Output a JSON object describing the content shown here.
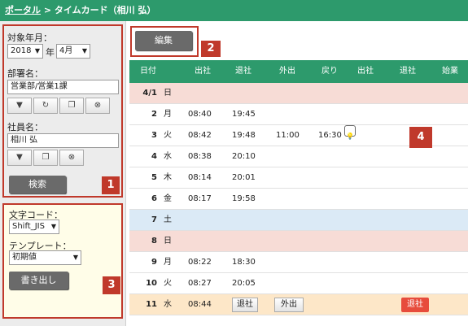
{
  "header": {
    "portal_link": "ポータル",
    "separator": " > ",
    "title": "タイムカード（相川 弘）"
  },
  "sidebar": {
    "period_label": "対象年月：",
    "year_value": "2018",
    "year_unit": "年",
    "month_value": "4月",
    "dept_label": "部署名：",
    "dept_value": "営業部/営業1課",
    "employee_label": "社員名：",
    "employee_value": "相川 弘",
    "search_label": "検索",
    "encoding_label": "文字コード：",
    "encoding_value": "Shift_JIS",
    "template_label": "テンプレート：",
    "template_value": "初期値",
    "export_label": "書き出し"
  },
  "toolbar": {
    "edit_label": "編集"
  },
  "badges": [
    "1",
    "2",
    "3",
    "4"
  ],
  "table": {
    "headers": [
      "日付",
      "出社",
      "退社",
      "外出",
      "戻り",
      "出社",
      "退社",
      "始業"
    ],
    "rows": [
      {
        "date": "4/1",
        "wd": "日",
        "in": "",
        "out": "",
        "go": "",
        "back": "",
        "kind": "hol"
      },
      {
        "date": "2",
        "wd": "月",
        "in": "08:40",
        "out": "19:45",
        "go": "",
        "back": "",
        "kind": ""
      },
      {
        "date": "3",
        "wd": "火",
        "in": "08:42",
        "out": "19:48",
        "go": "11:00",
        "back": "16:30",
        "kind": "",
        "memo": true
      },
      {
        "date": "4",
        "wd": "水",
        "in": "08:38",
        "out": "20:10",
        "go": "",
        "back": "",
        "kind": ""
      },
      {
        "date": "5",
        "wd": "木",
        "in": "08:14",
        "out": "20:01",
        "go": "",
        "back": "",
        "kind": ""
      },
      {
        "date": "6",
        "wd": "金",
        "in": "08:17",
        "out": "19:58",
        "go": "",
        "back": "",
        "kind": ""
      },
      {
        "date": "7",
        "wd": "土",
        "in": "",
        "out": "",
        "go": "",
        "back": "",
        "kind": "sat"
      },
      {
        "date": "8",
        "wd": "日",
        "in": "",
        "out": "",
        "go": "",
        "back": "",
        "kind": "hol"
      },
      {
        "date": "9",
        "wd": "月",
        "in": "08:22",
        "out": "18:30",
        "go": "",
        "back": "",
        "kind": ""
      },
      {
        "date": "10",
        "wd": "火",
        "in": "08:27",
        "out": "20:05",
        "go": "",
        "back": "",
        "kind": ""
      },
      {
        "date": "11",
        "wd": "水",
        "in": "08:44",
        "out": "",
        "go": "",
        "back": "",
        "kind": "cur"
      }
    ],
    "today_buttons": {
      "leave": "退社",
      "go_out": "外出",
      "leave_red": "退社"
    }
  },
  "colors": {
    "accent": "#2d9a6c",
    "marker": "#c0392b",
    "holiday": "#f7dcd6",
    "saturday": "#dbeaf6",
    "today": "#fde7c8"
  }
}
